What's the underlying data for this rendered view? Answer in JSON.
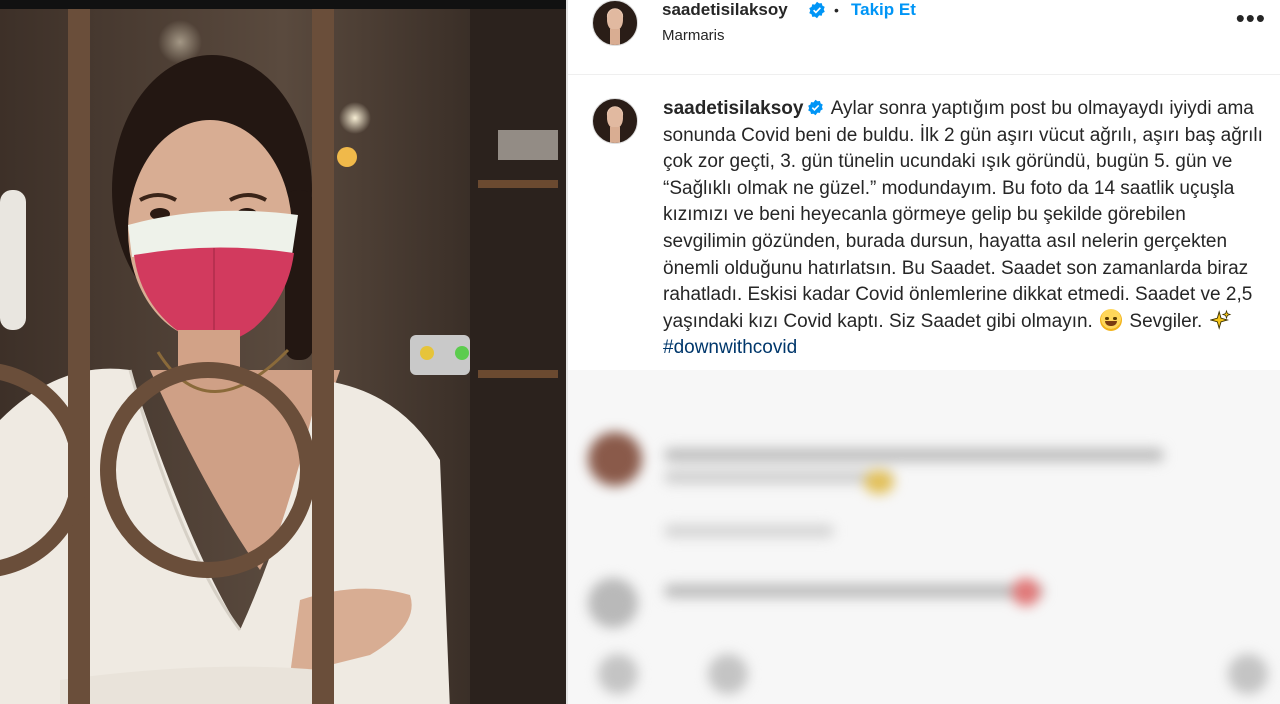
{
  "post": {
    "username": "saadetisilaksoy",
    "separator": "•",
    "follow_label": "Takip Et",
    "location": "Marmaris",
    "more_icon": "more-options-icon",
    "caption_parts": {
      "p1": "Aylar sonra yaptığım post bu olmayaydı iyiydi ama sonunda Covid beni de buldu. İlk 2 gün aşırı vücut ağrılı, aşırı baş ağrılı çok zor geçti, 3. gün tünelin ucundaki ışık göründü, bugün 5. gün ve “Sağlıklı olmak ne güzel.” modundayım. Bu foto da 14 saatlik uçuşla kızımızı ve beni heyecanla görmeye gelip bu şekilde görebilen sevgilimin gözünden, burada dursun, hayatta asıl nelerin gerçekten önemli olduğunu hatırlatsın. Bu Saadet. Saadet son zamanlarda biraz rahatladı. Eskisi kadar Covid önlemlerine dikkat etmedi. Saadet ve 2,5 yaşındaki kızı Covid kaptı. Siz Saadet gibi olmayın.",
      "p2": "Sevgiler.",
      "hashtag": "#downwithcovid"
    }
  },
  "colors": {
    "link_blue": "#0095f6",
    "hashtag_blue": "#00376b",
    "mask_pink": "#d23a5e",
    "text_dark": "#262626"
  }
}
